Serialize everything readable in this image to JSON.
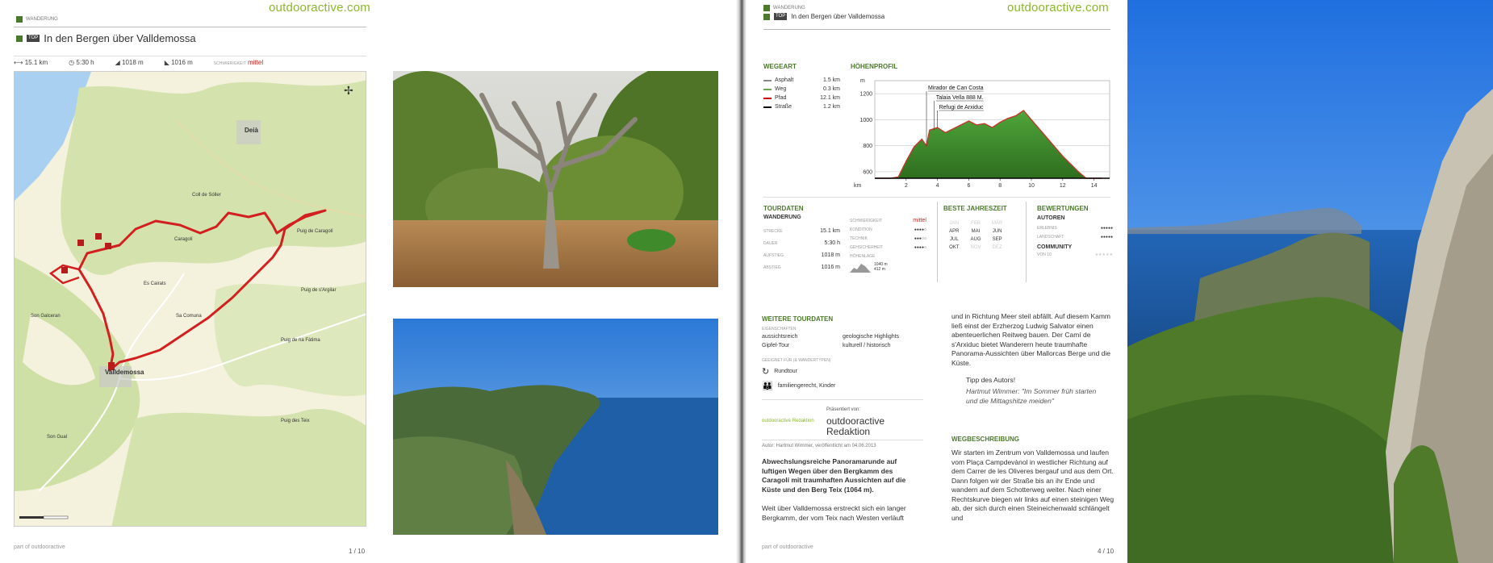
{
  "left_page": {
    "brand": "outdooractive.com",
    "category": "WANDERUNG",
    "tag": "TOP",
    "title": "In den Bergen über Valldemossa",
    "stats": {
      "distance": "15.1 km",
      "duration": "5:30 h",
      "ascent": "1018 m",
      "descent": "1016 m",
      "difficulty_label": "SCHWIERIGKEIT",
      "difficulty": "mittel"
    },
    "map": {
      "towns": {
        "deia": "Deià",
        "valldemossa": "Valldemossa",
        "caragoli": "Caragolí"
      },
      "labels": {
        "l1": "Puig de Caragolí",
        "l2": "Puig de s'Argilar",
        "l3": "Puig de na Fàtima",
        "l4": "Son Galceran",
        "l5": "Sa Comuna",
        "l6": "Es Cairats",
        "l7": "Coll de Sóller",
        "l8": "Son Gual",
        "l9": "Puig des Teix"
      }
    },
    "footer_part": "part of outdooractive",
    "page_number": "1 / 10"
  },
  "right_page": {
    "category": "WANDERUNG",
    "tag": "TOP",
    "title": "In den Bergen über Valldemossa",
    "brand": "outdooractive.com",
    "wegeart": {
      "heading": "WEGEART",
      "rows": [
        {
          "label": "Asphalt",
          "value": "1.5 km",
          "color": "#888888"
        },
        {
          "label": "Weg",
          "value": "0.3 km",
          "color": "#6aa84f"
        },
        {
          "label": "Pfad",
          "value": "12.1 km",
          "color": "#cc0000"
        },
        {
          "label": "Straße",
          "value": "1.2 km",
          "color": "#000000"
        }
      ]
    },
    "hoehenprofil": {
      "heading": "HÖHENPROFIL",
      "y_unit": "m",
      "x_unit": "km",
      "yticks": [
        "1200",
        "1000",
        "800",
        "600"
      ],
      "xticks": [
        "2",
        "4",
        "6",
        "8",
        "10",
        "12",
        "14"
      ],
      "annotations": [
        "Mirador de Can Costa",
        "Talaia Vella 888 M.",
        "Refugi de Arxiduc"
      ]
    },
    "tourdaten": {
      "heading": "TOURDATEN",
      "type": "WANDERUNG",
      "rows": [
        {
          "label": "STRECKE",
          "value": "15.1 km"
        },
        {
          "label": "DAUER",
          "value": "5:30 h"
        },
        {
          "label": "AUFSTIEG",
          "value": "1018 m"
        },
        {
          "label": "ABSTIEG",
          "value": "1016 m"
        }
      ],
      "right_rows": [
        {
          "label": "SCHWIERIGKEIT",
          "value": "mittel"
        },
        {
          "label": "KONDITION",
          "value": "●●●●○"
        },
        {
          "label": "TECHNIK",
          "value": "●●●○○"
        },
        {
          "label": "GEHSICHERHEIT",
          "value": "●●●●○"
        },
        {
          "label": "HÖHENLAGE",
          "value": ""
        }
      ],
      "altitude_max": "1040 m",
      "altitude_min": "412 m"
    },
    "jahreszeit": {
      "heading": "BESTE JAHRESZEIT",
      "months": [
        "JAN",
        "FEB",
        "MÄR",
        "APR",
        "MAI",
        "JUN",
        "JUL",
        "AUG",
        "SEP",
        "OKT",
        "NOV",
        "DEZ"
      ]
    },
    "bewertungen": {
      "heading": "BEWERTUNGEN",
      "autoren": "AUTOREN",
      "erlebnis": "ERLEBNIS",
      "landschaft": "LANDSCHAFT",
      "community": "COMMUNITY",
      "von": "VON 10"
    },
    "weitere": {
      "heading": "WEITERE TOURDATEN",
      "eigenschaften_label": "EIGENSCHAFTEN",
      "eigenschaften": [
        "aussichtsreich",
        "geologische Highlights",
        "Gipfel-Tour",
        "kulturell / historisch"
      ],
      "eignung_label": "GEEIGNET FÜR (& WANDERTYPEN)",
      "rundtour": "Rundtour",
      "familien": "familiengerecht, Kinder"
    },
    "presented": {
      "label": "Präsentiert von:",
      "logo_text": "outdooractive Redaktion",
      "name_line1": "outdooractive",
      "name_line2": "Redaktion",
      "author": "Autor: Hartmut Wimmer, veröffentlicht am 04.06.2013"
    },
    "intro": "Abwechslungsreiche Panoramarunde auf luftigen Wegen über den Bergkamm des Caragolí mit traumhaften Aussichten auf die Küste und den Berg Teix (1064 m).",
    "para1": "Weit über Valldemossa erstreckt sich ein langer Bergkamm, der vom Teix nach Westen verläuft",
    "para2": "und in Richtung Meer steil abfällt. Auf diesem Kamm ließ einst der Erzherzog Ludwig Salvator einen abenteuerlichen Reitweg bauen. Der Camí de s'Arxiduc bietet Wanderern heute traumhafte Panorama-Aussichten über Mallorcas Berge und die Küste.",
    "tipp_heading": "Tipp des Autors!",
    "tipp_author": "Hartmut Wimmer:",
    "tipp_text": "\"Im Sommer früh starten und die Mittagshitze meiden\"",
    "wegbeschreibung_heading": "WEGBESCHREIBUNG",
    "wegbeschreibung": "Wir starten im Zentrum von Valldemossa und laufen vom Plaça Campdevànol in westlicher Richtung auf dem Carrer de les Oliveres bergauf und aus dem Ort. Dann folgen wir der Straße bis an ihr Ende und wandern auf dem Schotterweg weiter. Nach einer Rechtskurve biegen wir links auf einen steinigen Weg ab, der sich durch einen Steineichenwald schlängelt und",
    "footer_part": "part of outdooractive",
    "page_number": "4 / 10"
  },
  "chart_data": {
    "type": "area",
    "title": "HÖHENPROFIL",
    "xlabel": "km",
    "ylabel": "m",
    "xlim": [
      0,
      15
    ],
    "ylim": [
      550,
      1300
    ],
    "x": [
      0,
      0.5,
      1,
      1.5,
      2,
      2.5,
      3,
      3.3,
      3.5,
      4,
      4.5,
      5,
      5.5,
      6,
      6.5,
      7,
      7.5,
      8,
      8.5,
      9,
      9.5,
      10,
      10.5,
      11,
      11.5,
      12,
      12.5,
      13,
      13.5,
      14,
      14.5
    ],
    "series": [
      {
        "values": [
          420,
          430,
          470,
          560,
          680,
          790,
          850,
          800,
          920,
          940,
          900,
          930,
          960,
          990,
          960,
          970,
          940,
          980,
          1010,
          1030,
          1070,
          1000,
          930,
          860,
          790,
          720,
          660,
          600,
          520,
          450,
          420
        ]
      }
    ]
  }
}
